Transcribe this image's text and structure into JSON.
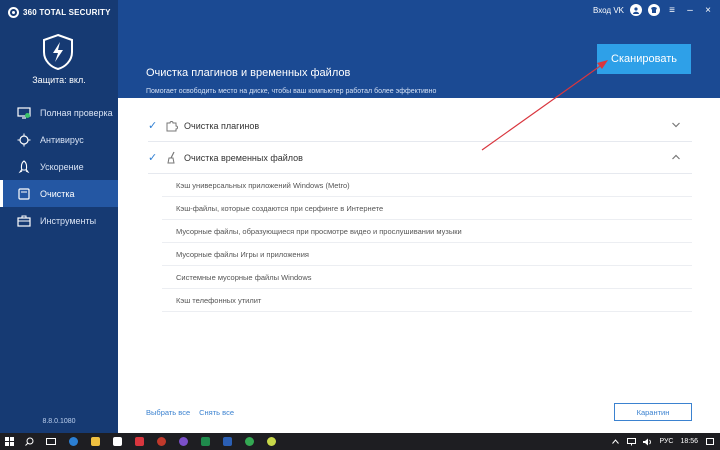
{
  "app": {
    "logo_text": "360 TOTAL SECURITY",
    "protection_status": "Защита: вкл.",
    "version": "8.8.0.1080"
  },
  "sidebar": {
    "items": [
      {
        "label": "Полная проверка",
        "icon": "scan-monitor-icon",
        "active": false
      },
      {
        "label": "Антивирус",
        "icon": "virus-icon",
        "active": false
      },
      {
        "label": "Ускорение",
        "icon": "rocket-icon",
        "active": false
      },
      {
        "label": "Очистка",
        "icon": "broom-icon",
        "active": true
      },
      {
        "label": "Инструменты",
        "icon": "toolbox-icon",
        "active": false
      }
    ]
  },
  "titlebar": {
    "login_label": "Вход VK",
    "buttons": [
      "menu-icon",
      "minimize-icon",
      "close-icon"
    ]
  },
  "header": {
    "title": "Очистка плагинов и временных файлов",
    "subtitle": "Помогает освободить место на диске, чтобы ваш компьютер работал более эффективно",
    "scan_button": "Сканировать"
  },
  "categories": [
    {
      "label": "Очистка плагинов",
      "checked": true,
      "expanded": false,
      "icon": "puzzle-icon"
    },
    {
      "label": "Очистка временных файлов",
      "checked": true,
      "expanded": true,
      "icon": "broom-icon"
    }
  ],
  "temp_items": [
    "Кэш универсальных приложений Windows (Metro)",
    "Кэш-файлы, которые создаются при серфинге в Интернете",
    "Мусорные файлы, образующиеся при просмотре видео и прослушивании музыки",
    "Мусорные файлы Игры и приложения",
    "Системные мусорные файлы Windows",
    "Кэш телефонных утилит"
  ],
  "footer": {
    "select_all": "Выбрать все",
    "deselect_all": "Снять все",
    "quarantine": "Карантин"
  },
  "taskbar": {
    "lang": "РУС",
    "time": "18:56"
  },
  "colors": {
    "sidebar": "#163a73",
    "header": "#1b4a93",
    "accent": "#2ea0e8",
    "link": "#3b82d0",
    "annotation": "#d9363e"
  }
}
